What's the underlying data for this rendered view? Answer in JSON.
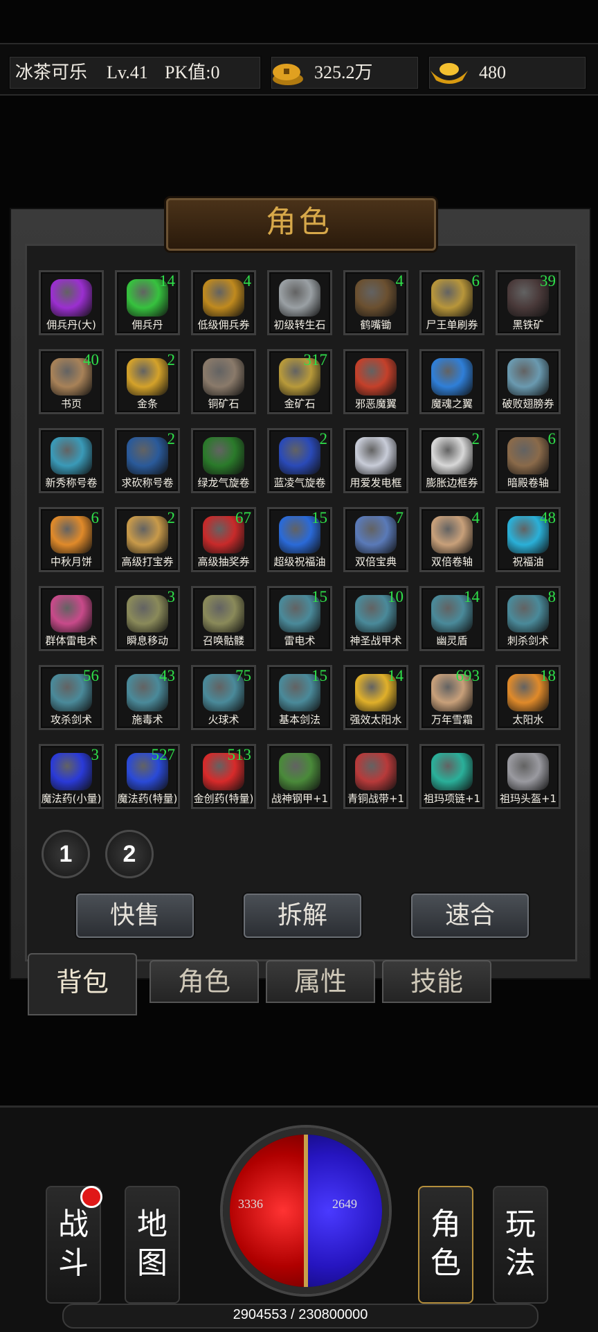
{
  "player": {
    "name": "冰茶可乐",
    "level": "Lv.41",
    "pk": "PK值:0",
    "gold": "325.2万",
    "ingots": "480"
  },
  "panel": {
    "title": "角色"
  },
  "items": [
    {
      "name": "佣兵丹(大)",
      "count": "",
      "color": "#9b2fd0"
    },
    {
      "name": "佣兵丹",
      "count": "14",
      "color": "#36c23e"
    },
    {
      "name": "低级佣兵券",
      "count": "4",
      "color": "#c08a1e"
    },
    {
      "name": "初级转生石",
      "count": "",
      "color": "#9aa0a4"
    },
    {
      "name": "鹤嘴锄",
      "count": "4",
      "color": "#6b5030"
    },
    {
      "name": "尸王单刷券",
      "count": "6",
      "color": "#b8963a"
    },
    {
      "name": "黑铁矿",
      "count": "39",
      "color": "#4a3a3a"
    },
    {
      "name": "书页",
      "count": "40",
      "color": "#a88258"
    },
    {
      "name": "金条",
      "count": "2",
      "color": "#d4a22a"
    },
    {
      "name": "铜矿石",
      "count": "",
      "color": "#8a7a6a"
    },
    {
      "name": "金矿石",
      "count": "317",
      "color": "#b89a3a"
    },
    {
      "name": "邪恶魔翼",
      "count": "",
      "color": "#c4402a"
    },
    {
      "name": "魔魂之翼",
      "count": "",
      "color": "#2f7fd8"
    },
    {
      "name": "破败翅膀券",
      "count": "",
      "color": "#6a9ab0"
    },
    {
      "name": "新秀称号卷",
      "count": "",
      "color": "#3a9ab8"
    },
    {
      "name": "求砍称号卷",
      "count": "2",
      "color": "#2a5a9a"
    },
    {
      "name": "绿龙气旋卷",
      "count": "",
      "color": "#2a7a2a"
    },
    {
      "name": "蓝凌气旋卷",
      "count": "2",
      "color": "#2a4ab8"
    },
    {
      "name": "用爱发电框",
      "count": "",
      "color": "#c8ccd8"
    },
    {
      "name": "膨胀边框券",
      "count": "2",
      "color": "#d8d8d8"
    },
    {
      "name": "暗殿卷轴",
      "count": "6",
      "color": "#8a6a4a"
    },
    {
      "name": "中秋月饼",
      "count": "6",
      "color": "#e08a2a"
    },
    {
      "name": "高级打宝券",
      "count": "2",
      "color": "#c89a4a"
    },
    {
      "name": "高级抽奖券",
      "count": "67",
      "color": "#c82a2a"
    },
    {
      "name": "超级祝福油",
      "count": "15",
      "color": "#2a6ad8"
    },
    {
      "name": "双倍宝典",
      "count": "7",
      "color": "#5a7ab8"
    },
    {
      "name": "双倍卷轴",
      "count": "4",
      "color": "#c8a07a"
    },
    {
      "name": "祝福油",
      "count": "48",
      "color": "#2ab0d8"
    },
    {
      "name": "群体雷电术",
      "count": "",
      "color": "#c84a8a"
    },
    {
      "name": "瞬息移动",
      "count": "3",
      "color": "#8a8a5a"
    },
    {
      "name": "召唤骷髅",
      "count": "",
      "color": "#8a8a5a"
    },
    {
      "name": "雷电术",
      "count": "15",
      "color": "#4a8a9a"
    },
    {
      "name": "神圣战甲术",
      "count": "10",
      "color": "#4a8a9a"
    },
    {
      "name": "幽灵盾",
      "count": "14",
      "color": "#4a8a9a"
    },
    {
      "name": "刺杀剑术",
      "count": "8",
      "color": "#4a8a9a"
    },
    {
      "name": "攻杀剑术",
      "count": "56",
      "color": "#4a8a9a"
    },
    {
      "name": "施毒术",
      "count": "43",
      "color": "#4a8a9a"
    },
    {
      "name": "火球术",
      "count": "75",
      "color": "#4a8a9a"
    },
    {
      "name": "基本剑法",
      "count": "15",
      "color": "#4a8a9a"
    },
    {
      "name": "强效太阳水",
      "count": "14",
      "color": "#e0b02a"
    },
    {
      "name": "万年雪霜",
      "count": "693",
      "color": "#c8a07a"
    },
    {
      "name": "太阳水",
      "count": "18",
      "color": "#e08a2a"
    },
    {
      "name": "魔法药(小量)",
      "count": "3",
      "color": "#2a3ad8"
    },
    {
      "name": "魔法药(特量)",
      "count": "527",
      "color": "#2a4ad8"
    },
    {
      "name": "金创药(特量)",
      "count": "513",
      "color": "#d82a2a"
    },
    {
      "name": "战神钢甲+1",
      "count": "",
      "color": "#4a8a3a"
    },
    {
      "name": "青铜战带+1",
      "count": "",
      "color": "#b83a3a"
    },
    {
      "name": "祖玛项链+1",
      "count": "",
      "color": "#2ab09a"
    },
    {
      "name": "祖玛头盔+1",
      "count": "",
      "color": "#9a9aa0"
    }
  ],
  "pages": [
    "1",
    "2"
  ],
  "actions": {
    "quick_sell": "快售",
    "dismantle": "拆解",
    "quick_merge": "速合"
  },
  "tabs": {
    "bag": "背包",
    "role": "角色",
    "attr": "属性",
    "skill": "技能"
  },
  "nav": {
    "battle": "战斗",
    "map": "地图",
    "role": "角色",
    "play": "玩法"
  },
  "stats": {
    "hp": "3336",
    "mp": "2649",
    "xp": "2904553 / 230800000"
  },
  "colors": {
    "count_green": "#2fe04a",
    "title_gold": "#d7a84a",
    "badge_red": "#e01818"
  }
}
